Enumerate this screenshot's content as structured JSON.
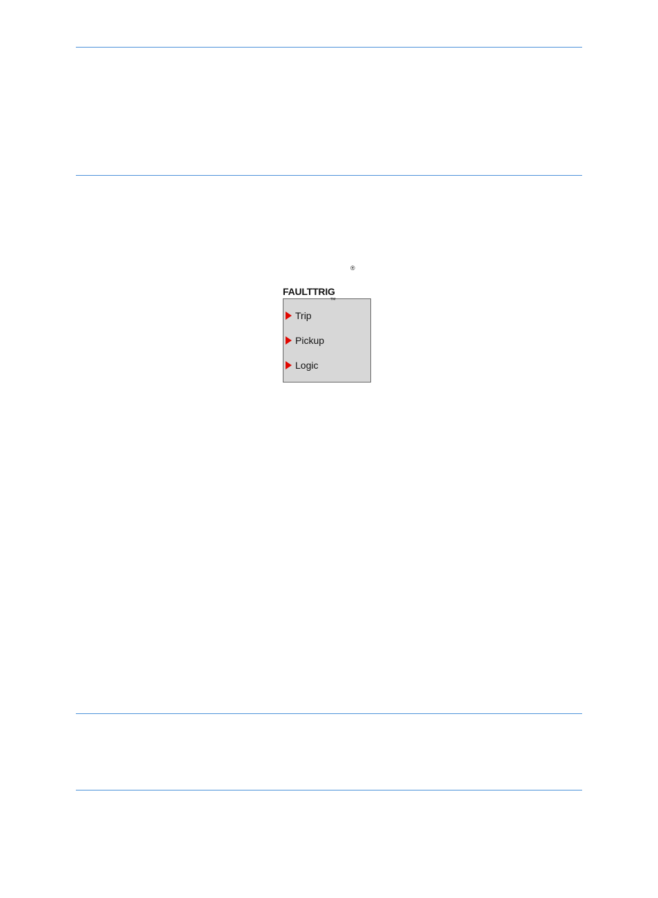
{
  "superscripts": {
    "registered": "®",
    "trademark": "™"
  },
  "fault_block": {
    "title": "FAULTTRIG",
    "rows": [
      {
        "label": "Trip"
      },
      {
        "label": "Pickup"
      },
      {
        "label": "Logic"
      }
    ]
  }
}
